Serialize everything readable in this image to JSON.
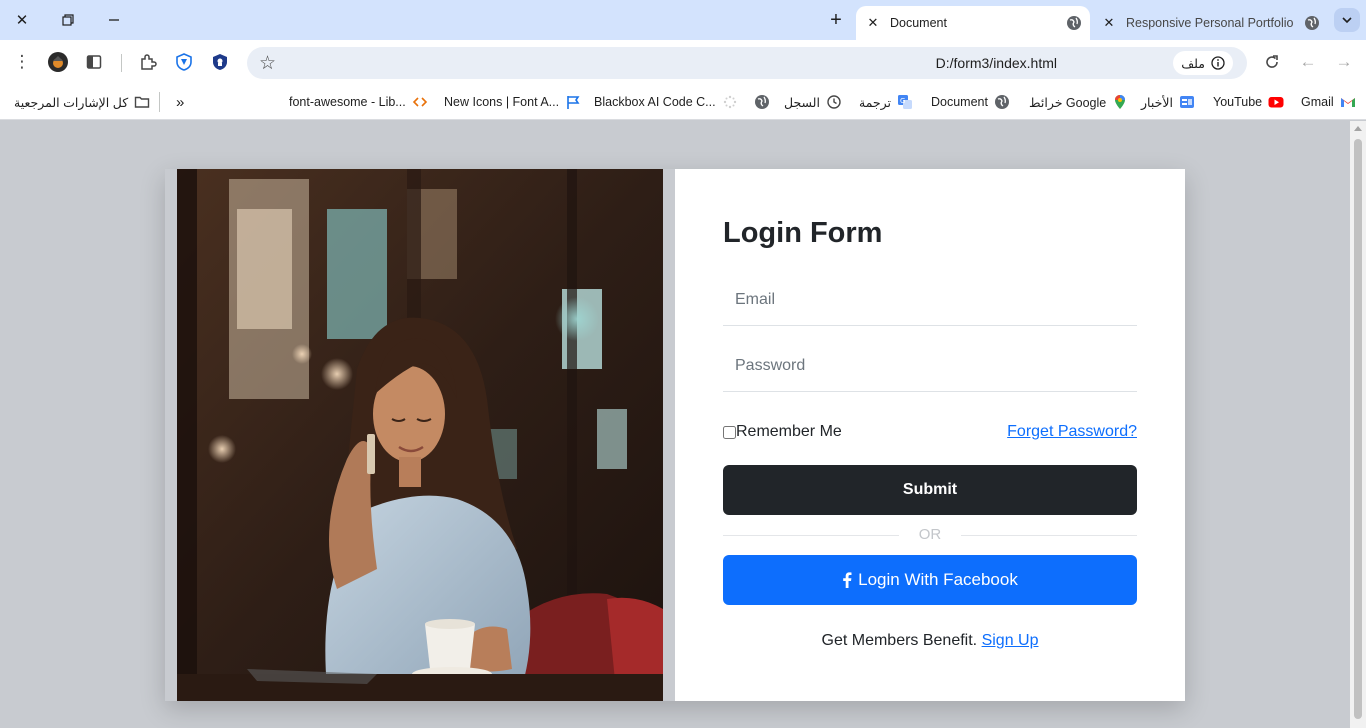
{
  "browser": {
    "tabs": [
      {
        "title": "Document",
        "active": true
      },
      {
        "title": "Responsive Personal Portfolio W",
        "active": false
      }
    ],
    "url": "D:/form3/index.html",
    "site_chip": "ملف",
    "bookmarks": [
      {
        "label": "Gmail",
        "icon": "gmail-icon"
      },
      {
        "label": "YouTube",
        "icon": "youtube-icon"
      },
      {
        "label": "الأخبار",
        "icon": "news-icon"
      },
      {
        "label": "خرائط Google",
        "icon": "maps-icon"
      },
      {
        "label": "Document",
        "icon": "globe-icon"
      },
      {
        "label": "ترجمة",
        "icon": "translate-icon"
      },
      {
        "label": "السجل",
        "icon": "history-icon"
      },
      {
        "label": "",
        "icon": "globe-icon"
      },
      {
        "label": "Blackbox AI Code C...",
        "icon": "blackbox-icon"
      },
      {
        "label": "New Icons | Font A...",
        "icon": "flag-icon"
      },
      {
        "label": "font-awesome - Lib...",
        "icon": "code-icon"
      }
    ],
    "all_bookmarks": "كل الإشارات المرجعية"
  },
  "login": {
    "title": "Login Form",
    "email_placeholder": "Email",
    "password_placeholder": "Password",
    "remember_label": "Remember Me",
    "forgot_label": "Forget Password?",
    "submit_label": "Submit",
    "or_label": "OR",
    "facebook_label": "Login With Facebook",
    "members_text": "Get Members Benefit.",
    "signup_label": "Sign Up"
  },
  "colors": {
    "page_bg": "#c8cbd0",
    "dark_button": "#212529",
    "facebook_blue": "#0d6efd",
    "link": "#0d6efd"
  }
}
